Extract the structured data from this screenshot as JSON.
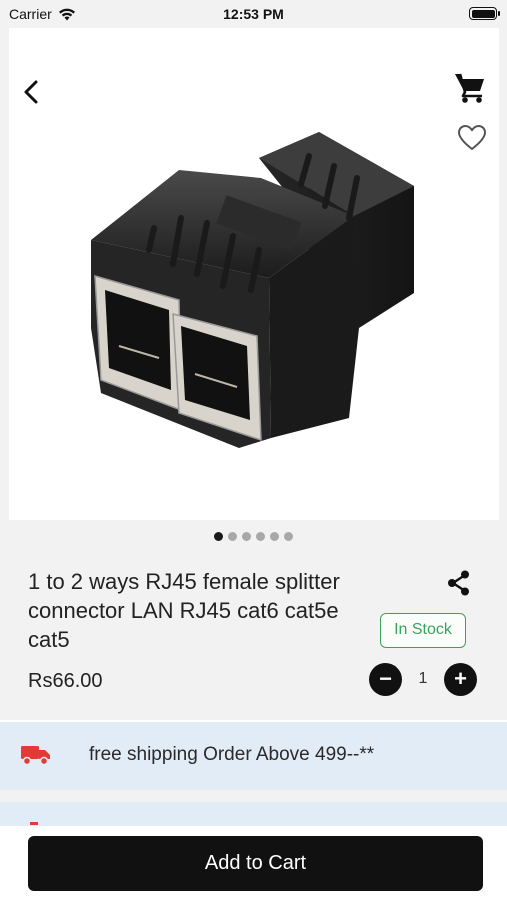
{
  "status_bar": {
    "carrier": "Carrier",
    "time": "12:53 PM"
  },
  "gallery": {
    "image_count": 6,
    "active_index": 0
  },
  "product": {
    "title": "1 to 2 ways RJ45 female splitter connector LAN RJ45 cat6 cat5e cat5",
    "price": "Rs66.00",
    "stock_status": "In Stock",
    "quantity": "1"
  },
  "shipping": {
    "text": "free shipping Order Above 499--**"
  },
  "actions": {
    "add_to_cart_label": "Add to Cart",
    "qty_decrement_symbol": "−",
    "qty_increment_symbol": "+"
  },
  "icons": [
    "wifi-icon",
    "battery-icon",
    "back-arrow-icon",
    "cart-icon",
    "heart-icon",
    "share-icon",
    "truck-icon"
  ],
  "colors": {
    "primary": "#111111",
    "in_stock": "#3aa35b",
    "shipping_bg": "#e2ecf7",
    "truck": "#e53935"
  }
}
